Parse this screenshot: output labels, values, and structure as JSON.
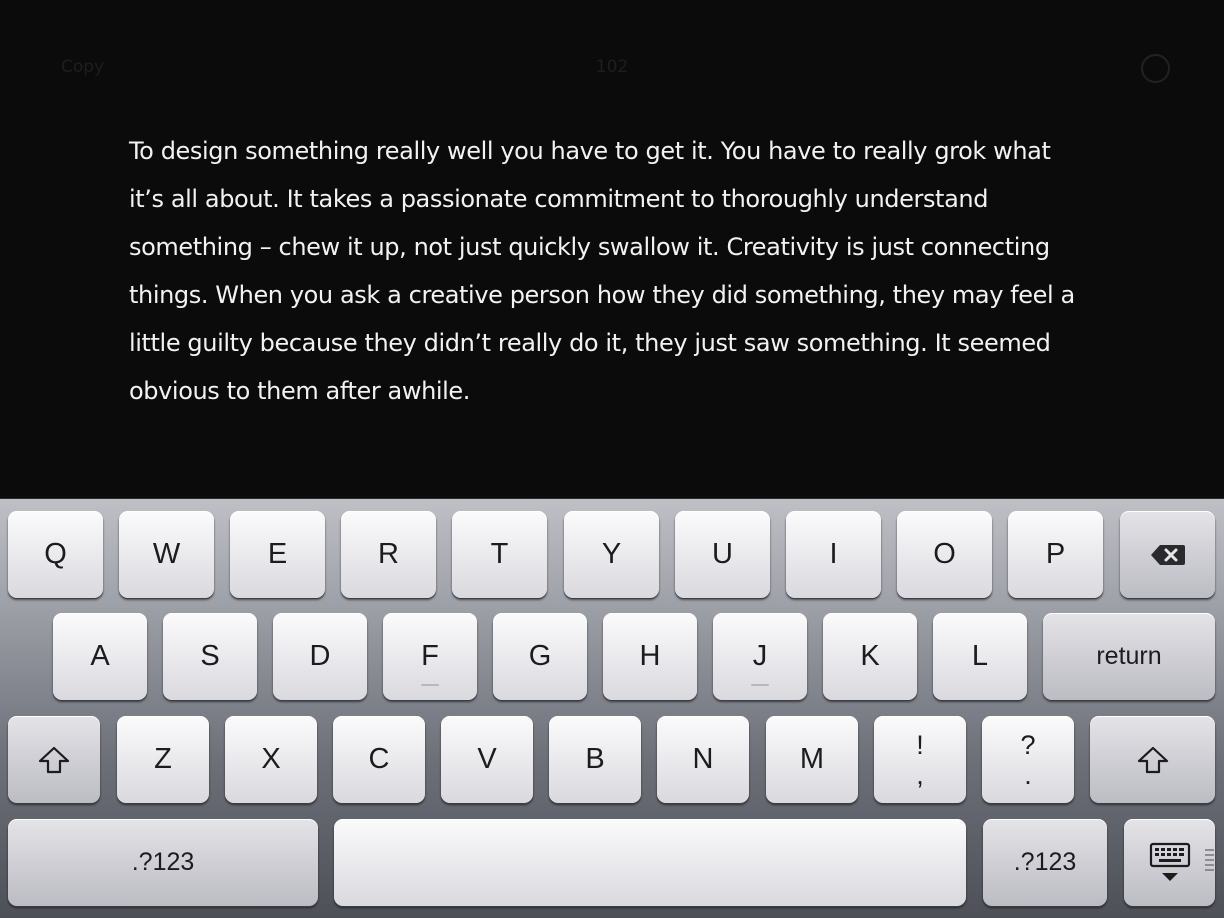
{
  "topbar": {
    "copy_label": "Copy",
    "word_count": "102",
    "right_icon": "circle-icon"
  },
  "document": {
    "text": "To design something really well you have to get it. You have to really grok what\nit’s all about. It takes a passionate commitment to thoroughly understand\nsomething – chew it up, not just quickly swallow it. Creativity is just connecting\nthings. When you ask a creative person how they did something, they may feel a\nlittle guilty because they didn’t really do it, they just saw something. It seemed\nobvious to them after awhile."
  },
  "keyboard": {
    "row1": [
      "Q",
      "W",
      "E",
      "R",
      "T",
      "Y",
      "U",
      "I",
      "O",
      "P"
    ],
    "backspace_icon": "backspace-icon",
    "row2": [
      "A",
      "S",
      "D",
      "F",
      "G",
      "H",
      "J",
      "K",
      "L"
    ],
    "return_label": "return",
    "shift_icon": "shift-icon",
    "row3": [
      "Z",
      "X",
      "C",
      "V",
      "B",
      "N",
      "M"
    ],
    "excl_top": "!",
    "excl_bottom": ",",
    "question_top": "?",
    "question_bottom": ".",
    "numbers_label": ".?123",
    "space_label": "",
    "dismiss_icon": "keyboard-dismiss-icon"
  }
}
